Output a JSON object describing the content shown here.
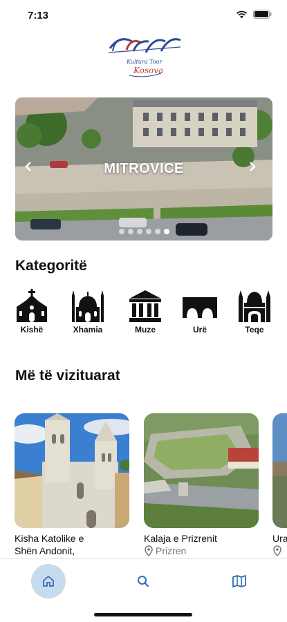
{
  "status_bar": {
    "time": "7:13"
  },
  "logo": {
    "script_line1": "Kultura Tour",
    "script_line2": "Kosova",
    "brand_blue": "#2b4a9c",
    "brand_red": "#c0392b"
  },
  "carousel": {
    "title": "MITROVICE",
    "slide_count": 6,
    "active_slide": 6,
    "prev_icon": "chevron-left",
    "next_icon": "chevron-right"
  },
  "sections": {
    "categories_title": "Kategoritë",
    "most_visited_title": "Më të vizituarat"
  },
  "categories": [
    {
      "label": "Kishë",
      "icon": "church-icon"
    },
    {
      "label": "Xhamia",
      "icon": "mosque-icon"
    },
    {
      "label": "Muze",
      "icon": "museum-icon"
    },
    {
      "label": "Urë",
      "icon": "bridge-icon"
    },
    {
      "label": "Teqe",
      "icon": "tekke-icon"
    }
  ],
  "most_visited": [
    {
      "title": "Kisha Katolike e",
      "subtitle": "Shën Andonit,",
      "location": ""
    },
    {
      "title": "Kalaja e Prizrenit",
      "subtitle": "",
      "location": "Prizren"
    },
    {
      "title": "Ura",
      "subtitle": "",
      "location": ""
    }
  ],
  "bottom_nav": [
    {
      "name": "home",
      "icon": "home-icon",
      "active": true
    },
    {
      "name": "search",
      "icon": "search-icon",
      "active": false
    },
    {
      "name": "map",
      "icon": "map-icon",
      "active": false
    }
  ],
  "colors": {
    "accent": "#2f6fb5",
    "nav_active_bg": "#c6dcee"
  }
}
